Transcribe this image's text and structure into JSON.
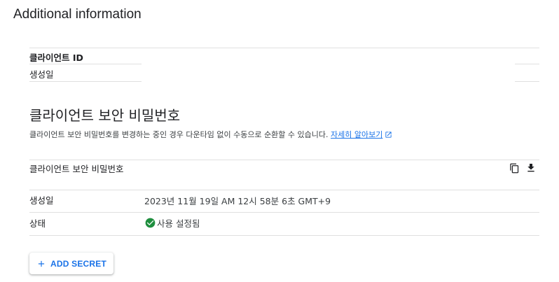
{
  "page": {
    "title": "Additional information"
  },
  "client_info": {
    "client_id_label": "클라이언트 ID",
    "client_id_value": "",
    "created_label": "생성일",
    "created_value": ""
  },
  "client_secret": {
    "section_title": "클라이언트 보안 비밀번호",
    "description": "클라이언트 보안 비밀번호를 변경하는 중인 경우 다운타임 없이 수동으로 순환할 수 있습니다.",
    "learn_more_link": "자세히 알아보기",
    "secret_label": "클라이언트 보안 비밀번호",
    "secret_value": "",
    "created_label": "생성일",
    "created_value": "2023년 11월 19일 AM 12시 58분 6초 GMT+9",
    "status_label": "상태",
    "status_value": "사용 설정됨",
    "add_button_label": "ADD SECRET"
  },
  "icons": {
    "copy": "copy-icon",
    "download": "download-icon",
    "status": "check-circle-icon",
    "external": "open-in-new-icon",
    "add": "plus-icon"
  },
  "colors": {
    "accent": "#1a73e8",
    "success": "#1e8e3e",
    "divider": "#e0e0e0",
    "text": "#202124"
  }
}
